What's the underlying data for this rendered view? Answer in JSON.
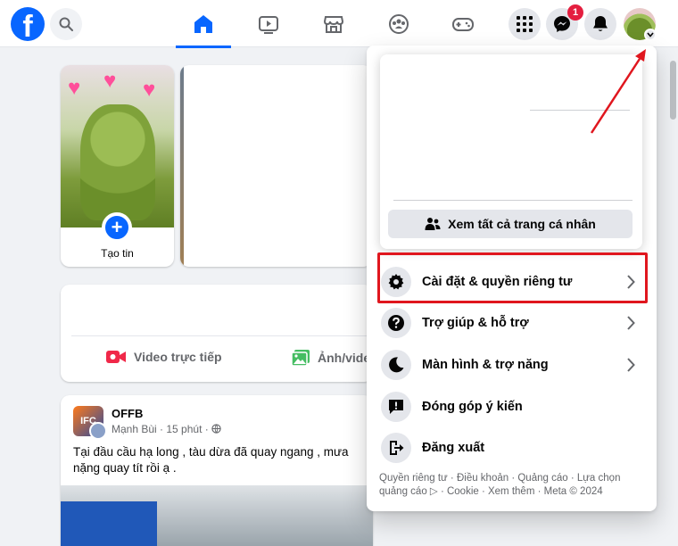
{
  "nav": {
    "logo": "f",
    "messenger_badge": "1"
  },
  "stories": {
    "create_label": "Tạo tin",
    "plus": "+"
  },
  "composer": {
    "live_video": "Video trực tiếp",
    "photo_video": "Ảnh/video"
  },
  "post": {
    "avatar_text": "IFC",
    "page_name": "OFFB",
    "author": "Mạnh Bùi",
    "time": "15 phút",
    "text": "Tại đầu cầu hạ long , tàu dừa đã quay ngang , mưa nặng quay tít rồi ạ ."
  },
  "menu": {
    "see_all_profiles": "Xem tất cả trang cá nhân",
    "items": [
      {
        "label": "Cài đặt & quyền riêng tư",
        "icon": "gear-icon",
        "chevron": true
      },
      {
        "label": "Trợ giúp & hỗ trợ",
        "icon": "question-icon",
        "chevron": true
      },
      {
        "label": "Màn hình & trợ năng",
        "icon": "moon-icon",
        "chevron": true
      },
      {
        "label": "Đóng góp ý kiến",
        "icon": "feedback-icon",
        "chevron": false
      },
      {
        "label": "Đăng xuất",
        "icon": "logout-icon",
        "chevron": false
      }
    ],
    "footer_line1": "Quyền riêng tư · Điều khoản · Quảng cáo · Lựa chọn",
    "footer_line2": "quảng cáo ▷ · Cookie · Xem thêm · Meta © 2024"
  },
  "colors": {
    "brand": "#0866ff",
    "highlight": "#e0161e",
    "badge": "#e41e3f"
  }
}
